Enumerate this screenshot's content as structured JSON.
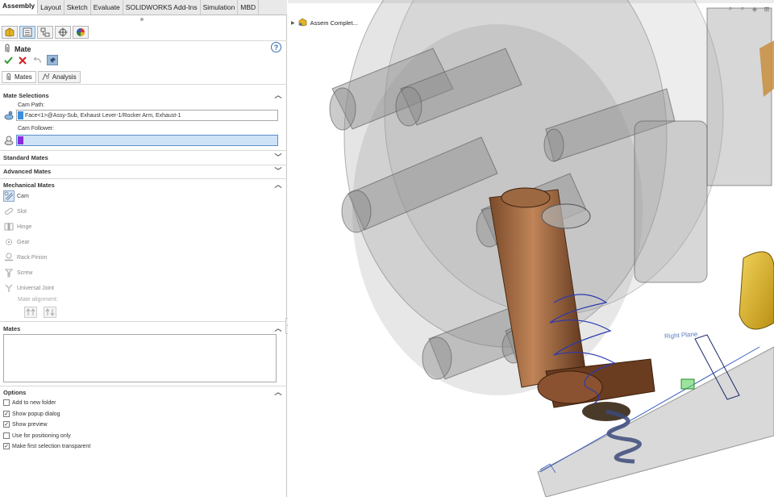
{
  "ribbon": {
    "tabs": [
      "Assembly",
      "Layout",
      "Sketch",
      "Evaluate",
      "SOLIDWORKS Add-Ins",
      "Simulation",
      "MBD"
    ],
    "active_tab": "Assembly"
  },
  "property_manager": {
    "title": "Mate",
    "subtabs": [
      "Mates",
      "Analysis"
    ],
    "sections": {
      "mate_selections": "Mate Selections",
      "standard_mates": "Standard Mates",
      "advanced_mates": "Advanced Mates",
      "mechanical_mates": "Mechanical Mates",
      "mates": "Mates",
      "options": "Options"
    },
    "cam_path_label": "Cam Path:",
    "cam_path_value": "Face<1>@Assy-Sub, Exhaust Lever-1/Rocker Arm, Exhaust-1",
    "cam_follower_label": "Cam Follower:",
    "cam_follower_value": "",
    "mechanical_items": [
      "Cam",
      "Slot",
      "Hinge",
      "Gear",
      "Rack Pinion",
      "Screw",
      "Universal Joint"
    ],
    "mate_alignment_label": "Mate alignment:",
    "options": [
      {
        "label": "Add to new folder",
        "checked": false
      },
      {
        "label": "Show popup dialog",
        "checked": true
      },
      {
        "label": "Show preview",
        "checked": true
      },
      {
        "label": "Use for positioning only",
        "checked": false
      },
      {
        "label": "Make first selection transparent",
        "checked": true
      }
    ],
    "colors": {
      "cam_path_swatch": "#3a8fe0",
      "cam_follower_swatch": "#8a2be2",
      "accept": "#2e9b2e",
      "cancel": "#d02020"
    }
  },
  "viewport": {
    "tree_root": "Assem Complet...",
    "plane_label": "Right Plane"
  }
}
